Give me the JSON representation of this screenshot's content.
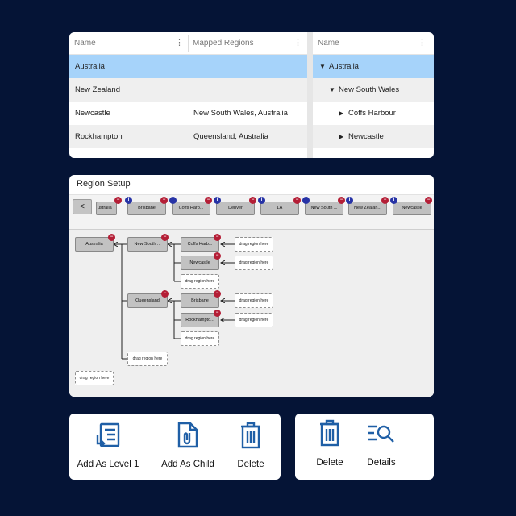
{
  "grid": {
    "columns": [
      "Name",
      "Mapped Regions"
    ],
    "rows": [
      {
        "name": "Australia",
        "regions": ""
      },
      {
        "name": "New Zealand",
        "regions": ""
      },
      {
        "name": "Newcastle",
        "regions": "New South Wales, Australia"
      },
      {
        "name": "Rockhampton",
        "regions": "Queensland, Australia"
      }
    ],
    "kebab": "⋮"
  },
  "tree_grid": {
    "column": "Name",
    "rows": [
      {
        "label": "Australia",
        "toggle": "▼"
      },
      {
        "label": "New South Wales",
        "toggle": "▼"
      },
      {
        "label": "Coffs Harbour",
        "toggle": "▶"
      },
      {
        "label": "Newcastle",
        "toggle": "▶"
      }
    ]
  },
  "region_setup": {
    "title": "Region Setup",
    "back_label": "<",
    "strip_chips": [
      "ustralia",
      "Brisbane",
      "Coffs Harb...",
      "Denver",
      "LA",
      "New South ...",
      "New Zealan...",
      "Newcastle"
    ],
    "info_mark": "i",
    "remove_mark": "−",
    "drop_label": "drag region here",
    "tree": {
      "root": "Australia",
      "nsw": "New South ...",
      "coffs": "Coffs Harb...",
      "newcastle": "Newcastle",
      "qld": "Queensland",
      "brisbane": "Brisbane",
      "rockhampton": "Rockhampto..."
    }
  },
  "actions": {
    "add_level1": "Add As Level 1",
    "add_child": "Add As Child",
    "delete": "Delete",
    "delete2": "Delete",
    "details": "Details"
  },
  "colors": {
    "background": "#051436",
    "selected_row": "#a6d3fa",
    "accent_icon": "#1f5fa6",
    "info_badge": "#2733a6",
    "remove_badge": "#b41e36"
  }
}
